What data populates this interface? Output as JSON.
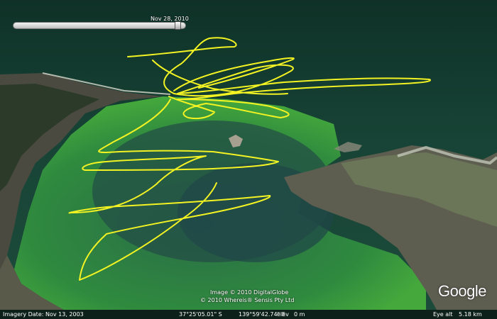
{
  "timeline": {
    "date_label": "Nov 28, 2010",
    "position_fraction": 0.97
  },
  "attribution": {
    "line1": "Image © 2010 DigitalGlobe",
    "line2": "© 2010 Whereis® Sensis Pty Ltd"
  },
  "logo": {
    "text": "Google"
  },
  "status": {
    "imagery_date": "Imagery Date: Nov 13, 2003",
    "latitude": "37°25'05.01\" S",
    "longitude": "139°59'42.74\" E",
    "elev_label": "elev",
    "elev_value": "0 m",
    "eye_alt_label": "Eye alt",
    "eye_alt_value": "5.18 km"
  },
  "colors": {
    "water": "#164a3a",
    "shallow_water": "#3fa23a",
    "land": "#5e5e50",
    "track": "#f3f323"
  },
  "icons": {
    "slider_thumb": "slider-thumb-icon"
  }
}
